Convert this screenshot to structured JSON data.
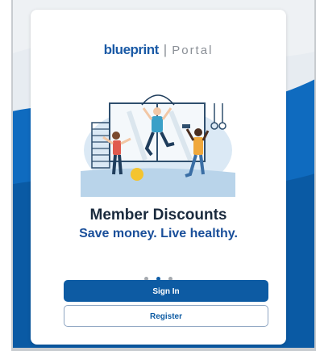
{
  "brand": {
    "logo_text": "blueprint",
    "separator": "|",
    "portal_label": "Portal"
  },
  "illustration": {
    "icon": "fitness-group-illustration"
  },
  "carousel": {
    "heading": "Member Discounts",
    "subheading": "Save money. Live healthy.",
    "slide_count": 3,
    "active_slide": 1
  },
  "actions": {
    "sign_in_label": "Sign In",
    "register_label": "Register"
  },
  "colors": {
    "primary": "#0d5ba3",
    "background_wave": "#1167b1",
    "heading": "#1a2a3d"
  }
}
